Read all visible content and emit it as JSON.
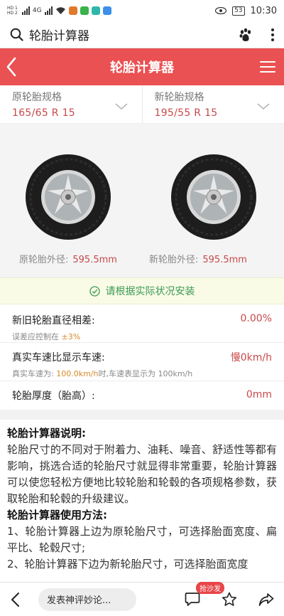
{
  "status_bar": {
    "sim1": "HD 1",
    "sim2": "HD 2",
    "network": "4G",
    "battery": "53",
    "time": "10:30"
  },
  "search_bar": {
    "query": "轮胎计算器"
  },
  "header": {
    "title": "轮胎计算器"
  },
  "specs": {
    "original": {
      "label": "原轮胎规格",
      "value": "165/65 R 15"
    },
    "new": {
      "label": "新轮胎规格",
      "value": "195/55 R 15"
    }
  },
  "diameters": {
    "original_label": "原轮胎外径:",
    "original_value": "595.5mm",
    "new_label": "新轮胎外径:",
    "new_value": "595.5mm"
  },
  "notice": "请根据实际状况安装",
  "rows": {
    "diameter_diff": {
      "name": "新旧轮胎直径相差:",
      "value": "0.00%",
      "sub_prefix": "误差应控制在",
      "sub_highlight": "±3%"
    },
    "speed": {
      "name": "真实车速比显示车速:",
      "value": "慢0km/h",
      "sub_prefix": "真实车速为:",
      "sub_highlight": "100.0km/h",
      "sub_suffix": "时,车速表显示为 100km/h"
    },
    "thickness": {
      "name": "轮胎厚度（胎高）:",
      "value": "0mm"
    }
  },
  "description": {
    "title1": "轮胎计算器说明:",
    "para1": "轮胎尺寸的不同对于附着力、油耗、噪音、舒适性等都有影响，挑选合适的轮胎尺寸就显得非常重要，轮胎计算器可以使您轻松方便地比较轮胎和轮毂的各项规格参数，获取轮胎和轮毂的升级建议。",
    "title2": "轮胎计算器使用方法:",
    "para2": "1、轮胎计算器上边为原轮胎尺寸，可选择胎面宽度、扁平比、轮毂尺寸;",
    "para3": "2、轮胎计算器下边为新轮胎尺寸，可选择胎面宽度"
  },
  "bottom_bar": {
    "comment_placeholder": "发表神评妙论...",
    "badge": "抢沙发"
  },
  "colors": {
    "header": "#ea5152",
    "accent_red": "#c8494a",
    "notice_green": "#3a9a54",
    "highlight_orange": "#d88a2a"
  }
}
